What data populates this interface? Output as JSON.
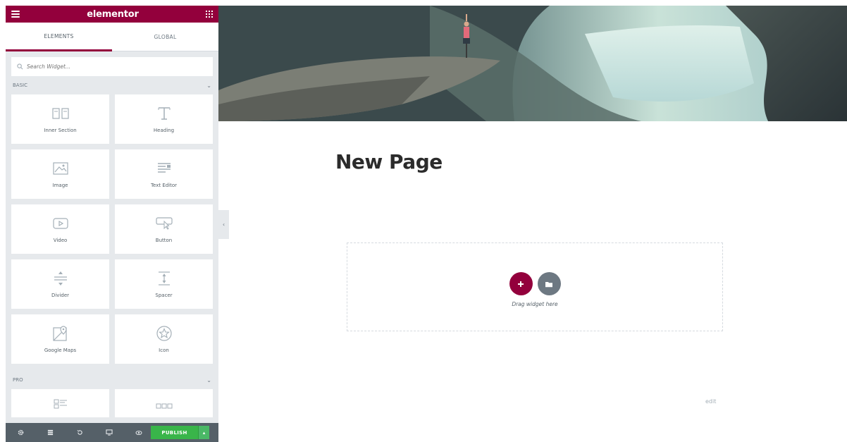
{
  "app": {
    "logo": "elementor"
  },
  "tabs": [
    {
      "label": "ELEMENTS",
      "active": true
    },
    {
      "label": "GLOBAL",
      "active": false
    }
  ],
  "search": {
    "placeholder": "Search Widget..."
  },
  "categories": {
    "basic": {
      "title": "BASIC",
      "widgets": [
        {
          "label": "Inner Section",
          "icon": "columns-icon"
        },
        {
          "label": "Heading",
          "icon": "heading-icon"
        },
        {
          "label": "Image",
          "icon": "image-icon"
        },
        {
          "label": "Text Editor",
          "icon": "text-editor-icon"
        },
        {
          "label": "Video",
          "icon": "video-icon"
        },
        {
          "label": "Button",
          "icon": "button-icon"
        },
        {
          "label": "Divider",
          "icon": "divider-icon"
        },
        {
          "label": "Spacer",
          "icon": "spacer-icon"
        },
        {
          "label": "Google Maps",
          "icon": "map-icon"
        },
        {
          "label": "Icon",
          "icon": "star-icon"
        }
      ]
    },
    "pro": {
      "title": "PRO"
    }
  },
  "footer": {
    "publish_label": "PUBLISH"
  },
  "preview": {
    "page_title": "New Page",
    "drop_hint": "Drag widget here",
    "edit_link": "edit"
  },
  "colors": {
    "brand": "#93003c",
    "panel_bg": "#e6e9ec",
    "footer_bg": "#556068",
    "publish_green": "#39b54a",
    "template_gray": "#6d7882"
  }
}
